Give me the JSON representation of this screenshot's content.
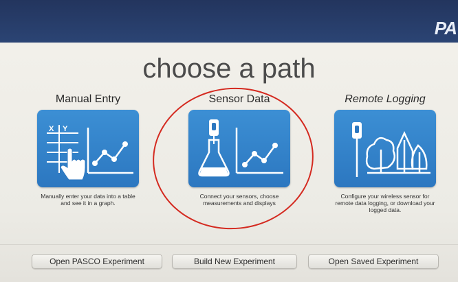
{
  "brand": {
    "text": "PA"
  },
  "heading": "choose a path",
  "paths": [
    {
      "label": "Manual Entry",
      "icon": "manual-entry-icon",
      "description_line1": "Manually enter your data into a table",
      "description_line2": "and see it in a graph."
    },
    {
      "label": "Sensor Data",
      "icon": "sensor-data-icon",
      "description_line1": "Connect your sensors, choose",
      "description_line2": "measurements and displays"
    },
    {
      "label": "Remote Logging",
      "icon": "remote-logging-icon",
      "description_line1": "Configure your wireless sensor for",
      "description_line2": "remote data logging, or download your",
      "description_line3": "logged data."
    }
  ],
  "buttons": {
    "open_pasco": "Open PASCO Experiment",
    "build_new": "Build New Experiment",
    "open_saved": "Open Saved Experiment"
  },
  "colors": {
    "header": "#23355e",
    "tile": "#2f7dc5",
    "highlight": "#d42a20"
  }
}
